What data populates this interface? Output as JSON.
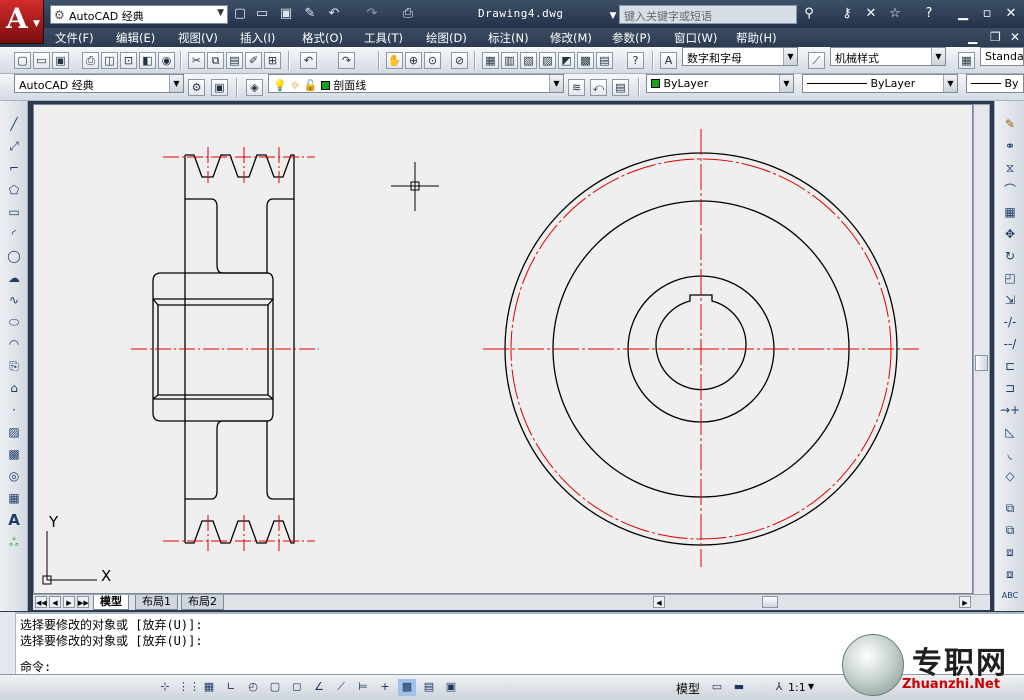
{
  "window": {
    "title": "Drawing4.dwg",
    "workspace": "AutoCAD 经典",
    "search_placeholder": "键入关键字或短语",
    "logo_letter": "A"
  },
  "menus": [
    "文件(F)",
    "编辑(E)",
    "视图(V)",
    "插入(I)",
    "格式(O)",
    "工具(T)",
    "绘图(D)",
    "标注(N)",
    "修改(M)",
    "参数(P)",
    "窗口(W)",
    "帮助(H)"
  ],
  "toolbar": {
    "text_style": "数字和字母",
    "dim_style": "机械样式",
    "table_style": "Standa",
    "workspace": "AutoCAD 经典",
    "layer": "剖面线",
    "color": "ByLayer",
    "linetype": "ByLayer",
    "lineweight": "By"
  },
  "tabs": [
    "模型",
    "布局1",
    "布局2"
  ],
  "command": {
    "history": [
      "选择要修改的对象或 [放弃(U)]:",
      "选择要修改的对象或 [放弃(U)]:"
    ],
    "prompt": "命令:"
  },
  "status": {
    "space": "模型",
    "scale": "1:1"
  },
  "ucs": {
    "x_label": "X",
    "y_label": "Y"
  },
  "watermark": {
    "text": "专职网",
    "url": "Zhuanzhi.Net"
  },
  "colors": {
    "layer_green": "#1aa31a",
    "centerline_red": "#e00000",
    "canvas": "#efefef"
  }
}
